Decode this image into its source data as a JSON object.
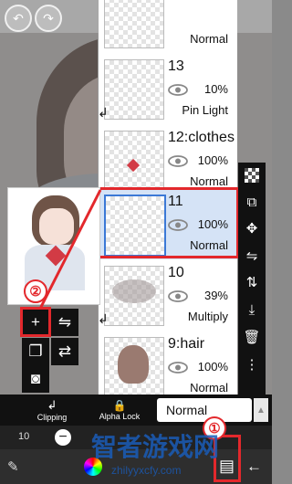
{
  "layers": [
    {
      "name": "",
      "opacity": "",
      "blend": "Normal",
      "clipped": false
    },
    {
      "name": "13",
      "opacity": "10%",
      "blend": "Pin Light",
      "clipped": true
    },
    {
      "name": "12:clothes",
      "opacity": "100%",
      "blend": "Normal",
      "clipped": false
    },
    {
      "name": "11",
      "opacity": "100%",
      "blend": "Normal",
      "clipped": false,
      "selected": true
    },
    {
      "name": "10",
      "opacity": "39%",
      "blend": "Multiply",
      "clipped": true
    },
    {
      "name": "9:hair",
      "opacity": "100%",
      "blend": "Normal",
      "clipped": false
    }
  ],
  "annotations": {
    "step1": "①",
    "step2": "②"
  },
  "left_tools": {
    "add": "+"
  },
  "bottom": {
    "clipping": "Clipping",
    "alpha_lock": "Alpha Lock",
    "blend_mode": "Normal",
    "opacity_value": "10"
  },
  "watermark": {
    "title": "智者游戏网",
    "url": "zhilyyxcfy.com"
  },
  "icons": [
    "undo-icon",
    "redo-icon",
    "eye-icon",
    "checker-icon",
    "transform-icon",
    "move-icon",
    "flip-h-icon",
    "flip-v-icon",
    "merge-down-icon",
    "trash-icon",
    "more-icon",
    "camera-icon",
    "layers-icon",
    "brush-icon",
    "color-wheel-icon"
  ]
}
